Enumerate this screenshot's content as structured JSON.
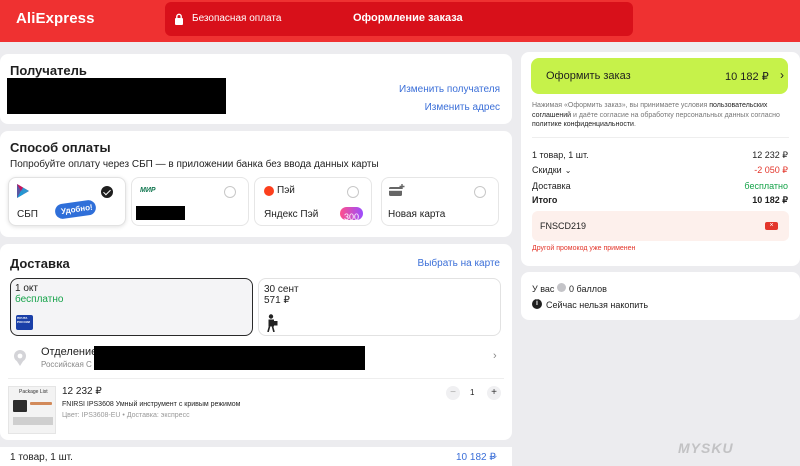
{
  "header": {
    "logo": "AliExpress",
    "secure_payment": "Безопасная оплата",
    "page_title": "Оформление заказа"
  },
  "recipient": {
    "title": "Получатель",
    "change_recipient": "Изменить получателя",
    "change_address": "Изменить адрес"
  },
  "payment": {
    "title": "Способ оплаты",
    "hint": "Попробуйте оплату через СБП — в приложении банка без ввода данных карты",
    "sbp": {
      "label": "СБП",
      "badge": "Удобно!"
    },
    "mir": {
      "brand": "МИР"
    },
    "yandex": {
      "brand": "Пэй",
      "label": "Яндекс Пэй",
      "bonus": "300"
    },
    "new_card": {
      "label": "Новая карта"
    }
  },
  "delivery": {
    "title": "Доставка",
    "map_link": "Выбрать на карте",
    "options": [
      {
        "date": "1 окт",
        "price": "бесплатно",
        "carrier": "ПОЧТА РОССИИ"
      },
      {
        "date": "30 сент",
        "price": "571 ₽"
      }
    ],
    "office_title": "Отделение",
    "office_sub": "Российская С",
    "item": {
      "price": "12 232 ₽",
      "name": "FNIRSI IPS3608 Умный инструмент с кривым режимом",
      "meta": "Цвет: IPS3608-EU • Доставка: экспресс",
      "qty": "1",
      "thumb_label": "Package List"
    }
  },
  "footer_bar": {
    "summary": "1 товар, 1 шт.",
    "total": "10 182 ₽"
  },
  "checkout": {
    "button_label": "Оформить заказ",
    "button_total": "10 182 ₽",
    "legal_1": "Нажимая «Оформить заказ», вы принимаете условия ",
    "legal_link_1": "пользовательских соглашений",
    "legal_2": " и даёте согласие на обработку персональных данных согласно ",
    "legal_link_2": "политике конфиденциальности",
    "legal_3": "."
  },
  "summary": {
    "rows": [
      {
        "label": "1 товар, 1 шт.",
        "value": "12 232 ₽"
      },
      {
        "label": "Скидки",
        "value": "-2 050 ₽"
      },
      {
        "label": "Доставка",
        "value": "бесплатно"
      }
    ],
    "total_label": "Итого",
    "total_value": "10 182 ₽",
    "promo_code": "FNSCD219",
    "promo_error": "Другой промокод уже применен"
  },
  "points": {
    "have_prefix": "У вас",
    "have_value": "0 баллов",
    "cannot_accumulate": "Сейчас нельзя накопить"
  },
  "colors": {
    "brand": "#ef3131",
    "header_box": "#d8101a",
    "checkout_button": "#c6f24a",
    "link": "#3b6fd8",
    "discount": "#e3362b",
    "free": "#16a34a",
    "promo_bg": "#fdf0ec"
  },
  "watermark": "MYSKU"
}
